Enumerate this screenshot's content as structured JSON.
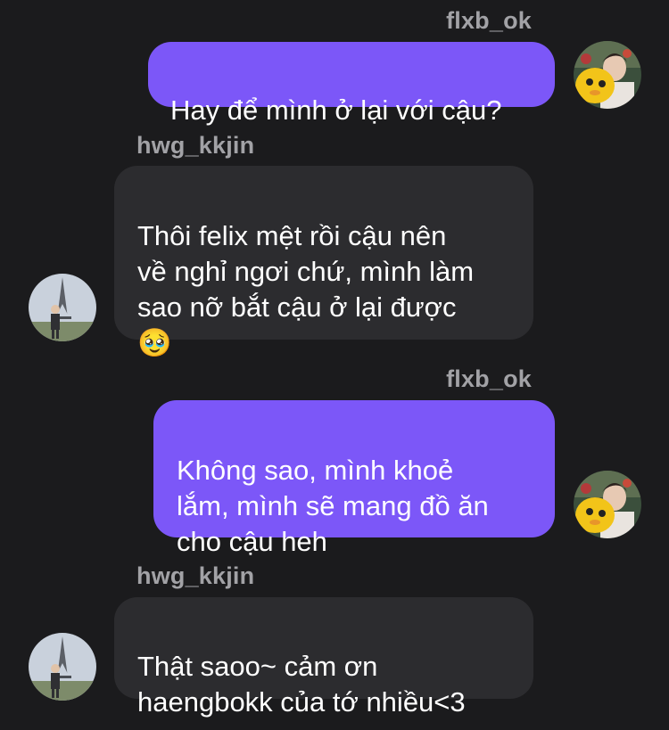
{
  "messages": [
    {
      "sender": "flxb_ok",
      "direction": "outgoing",
      "text": "Hay để mình ở lại với cậu?"
    },
    {
      "sender": "hwg_kkjin",
      "direction": "incoming",
      "text": "Thôi felix mệt rồi cậu nên\nvề nghỉ ngơi chứ, mình làm\nsao nỡ bắt cậu ở lại được\n🥹"
    },
    {
      "sender": "flxb_ok",
      "direction": "outgoing",
      "text": "Không sao, mình khoẻ\nlắm, mình sẽ mang đồ ăn\ncho cậu heh"
    },
    {
      "sender": "hwg_kkjin",
      "direction": "incoming",
      "text": "Thật saoo~ cảm ơn\nhaengbokk của tớ nhiều<3"
    }
  ],
  "colors": {
    "background": "#1b1b1d",
    "outgoing_bubble": "#7c57f8",
    "incoming_bubble": "#2c2c2f",
    "username": "#a2a2a6",
    "message_text": "#ffffff"
  },
  "icons": {
    "outgoing_avatar": "profile-photo-person-with-yellow-plush",
    "incoming_avatar": "profile-photo-person-at-eiffel-tower"
  }
}
